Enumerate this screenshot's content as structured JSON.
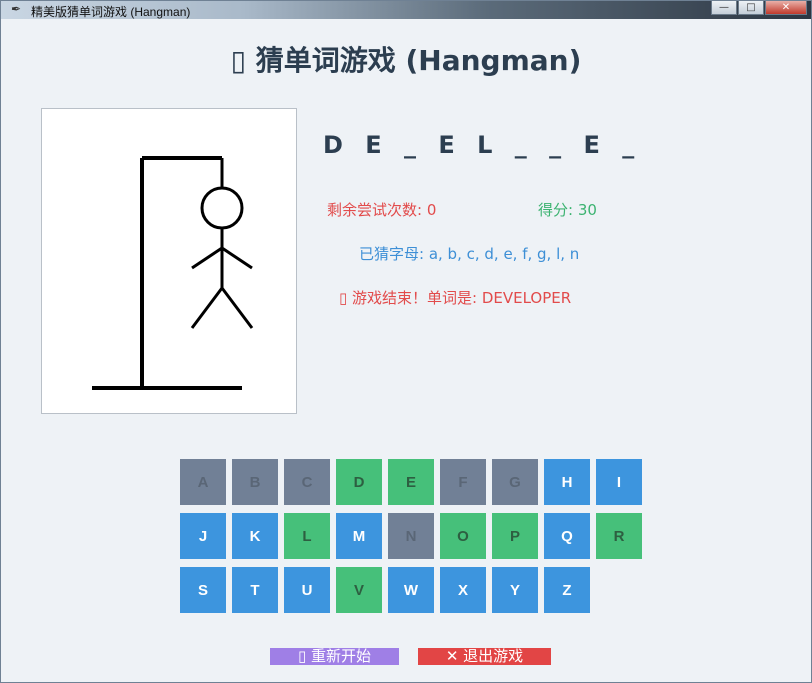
{
  "window": {
    "title": "精美版猜单词游戏 (Hangman)",
    "minimize_glyph": "—",
    "maximize_glyph": "□",
    "close_glyph": "✕"
  },
  "game": {
    "title": "▯ 猜单词游戏 (Hangman)",
    "word_display": "D E _ E L _ _ E _",
    "tries_text": "剩余尝试次数: 0",
    "score_text": "得分: 30",
    "guessed_text": "已猜字母: a, b, c, d, e, f, g, l, n",
    "message": "▯ 游戏结束！单词是: DEVELOPER"
  },
  "keyboard": {
    "rows": [
      [
        {
          "letter": "A",
          "state": "wrong"
        },
        {
          "letter": "B",
          "state": "wrong"
        },
        {
          "letter": "C",
          "state": "wrong"
        },
        {
          "letter": "D",
          "state": "correct"
        },
        {
          "letter": "E",
          "state": "correct"
        },
        {
          "letter": "F",
          "state": "wrong"
        },
        {
          "letter": "G",
          "state": "wrong"
        },
        {
          "letter": "H",
          "state": "available"
        },
        {
          "letter": "I",
          "state": "available"
        }
      ],
      [
        {
          "letter": "J",
          "state": "available"
        },
        {
          "letter": "K",
          "state": "available"
        },
        {
          "letter": "L",
          "state": "correct"
        },
        {
          "letter": "M",
          "state": "available"
        },
        {
          "letter": "N",
          "state": "wrong"
        },
        {
          "letter": "O",
          "state": "correct"
        },
        {
          "letter": "P",
          "state": "correct"
        },
        {
          "letter": "Q",
          "state": "available"
        },
        {
          "letter": "R",
          "state": "correct"
        }
      ],
      [
        {
          "letter": "S",
          "state": "available"
        },
        {
          "letter": "T",
          "state": "available"
        },
        {
          "letter": "U",
          "state": "available"
        },
        {
          "letter": "V",
          "state": "correct"
        },
        {
          "letter": "W",
          "state": "available"
        },
        {
          "letter": "X",
          "state": "available"
        },
        {
          "letter": "Y",
          "state": "available"
        },
        {
          "letter": "Z",
          "state": "available"
        }
      ]
    ]
  },
  "buttons": {
    "restart_label": "▯ 重新开始",
    "quit_label": "✕ 退出游戏"
  },
  "colors": {
    "available_key": "#3d95de",
    "correct_key": "#46c07a",
    "wrong_key": "#718096",
    "restart_button": "#9f7fe6",
    "quit_button": "#e24545",
    "title_text": "#2c3e50"
  },
  "icons": {
    "window_icon": "feather-icon",
    "title_icon": "game-icon",
    "restart_icon": "refresh-icon",
    "quit_icon": "close-icon"
  }
}
